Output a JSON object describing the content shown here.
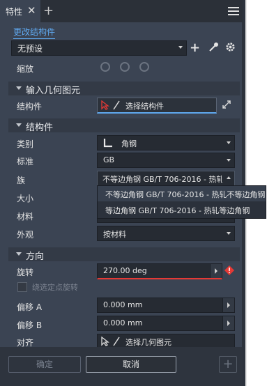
{
  "tab": {
    "title": "特性",
    "close_glyph": "✕",
    "add_glyph": "+"
  },
  "link": {
    "label": "更改结构件"
  },
  "preset": {
    "value": "无预设"
  },
  "zoom": {
    "label": "缩放"
  },
  "sections": {
    "geometry": {
      "title": "输入几何图元"
    },
    "member": {
      "title": "结构件"
    },
    "orientation": {
      "title": "方向"
    }
  },
  "geometry": {
    "member_label": "结构件",
    "member_value": "选择结构件"
  },
  "member": {
    "category_label": "类别",
    "category_value": "角钢",
    "standard_label": "标准",
    "standard_value": "GB",
    "family_label": "族",
    "family_value": "不等边角钢 GB/T 706-2016 - 热轧",
    "size_label": "大小",
    "material_label": "材料",
    "appearance_label": "外观",
    "appearance_value": "按材料",
    "family_options": [
      "不等边角钢 GB/T 706-2016 - 热轧不等边角钢",
      "等边角钢 GB/T 706-2016 - 热轧等边角钢"
    ]
  },
  "orientation": {
    "rotate_label": "旋转",
    "rotate_value": "270.00 deg",
    "snap_rotate_label": "绕选定点旋转",
    "offset_a_label": "偏移 A",
    "offset_a_value": "0.000 mm",
    "offset_b_label": "偏移 B",
    "offset_b_value": "0.000 mm",
    "align_label": "对齐",
    "align_value": "选择几何图元"
  },
  "footer": {
    "ok_label": "确定",
    "cancel_label": "取消",
    "add_glyph": "+"
  },
  "colors": {
    "accent": "#5fa8ef",
    "error": "#e53935",
    "panel": "#3b4453"
  }
}
